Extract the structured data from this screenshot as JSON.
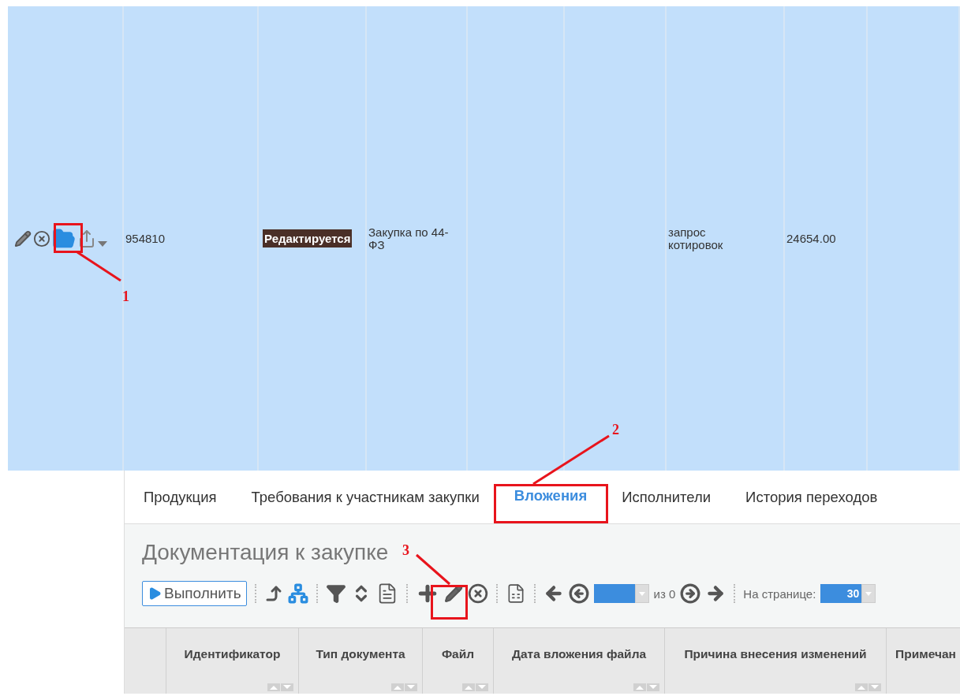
{
  "record_row": {
    "selected": true,
    "cells": [
      {
        "kind": "actions"
      },
      {
        "kind": "text",
        "text": "954810"
      },
      {
        "kind": "badge",
        "text": "Редактируется"
      },
      {
        "kind": "text",
        "text": "Закупка по 44-ФЗ"
      },
      {
        "kind": "empty"
      },
      {
        "kind": "empty"
      },
      {
        "kind": "text",
        "text": "запрос котировок"
      },
      {
        "kind": "text",
        "text": "24654.00"
      },
      {
        "kind": "empty"
      }
    ]
  },
  "tabs": [
    {
      "label": "Продукция",
      "selected": false
    },
    {
      "label": "Требования к участникам закупки",
      "selected": false
    },
    {
      "label": "Вложения",
      "selected": true
    },
    {
      "label": "Исполнители",
      "selected": false
    },
    {
      "label": "История переходов",
      "selected": false
    }
  ],
  "section_title": "Документация к закупке",
  "toolbar": {
    "run_button": "Выполнить",
    "pager_of": "из 0",
    "page_size_label": "На странице:",
    "page_size": "30"
  },
  "table": {
    "columns": [
      "",
      "Идентификатор",
      "Тип документа",
      "Файл",
      "Дата вложения файла",
      "Причина внесения изменений",
      "Примечан"
    ]
  },
  "annotations": [
    "1",
    "2",
    "3"
  ]
}
